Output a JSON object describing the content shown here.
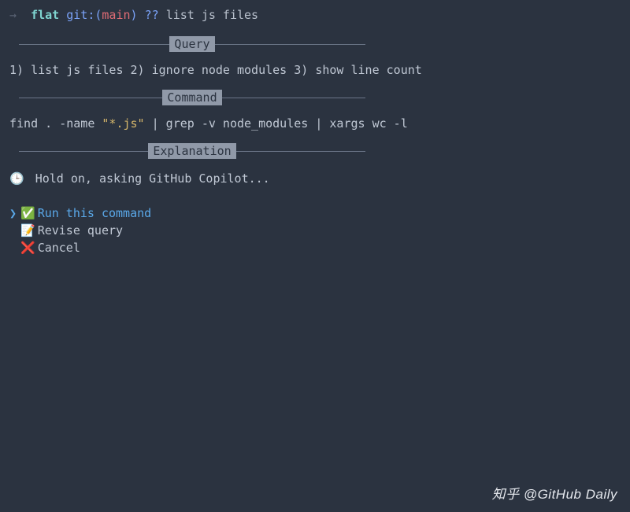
{
  "prompt": {
    "arrow": "→",
    "dirname": "flat",
    "git_label": "git:",
    "branch": "main",
    "qmarks": "??",
    "input": "list js files"
  },
  "sections": {
    "query_label": "Query",
    "query_text": "1) list js files 2) ignore node modules 3) show line count",
    "command_label": "Command",
    "command_prefix": "find . -name ",
    "command_string": "\"*.js\"",
    "command_suffix": " | grep -v node_modules | xargs wc -l",
    "explanation_label": "Explanation"
  },
  "status": {
    "icon": "🕒",
    "text": "Hold on, asking GitHub Copilot..."
  },
  "menu": {
    "caret": "❯",
    "items": [
      {
        "icon": "✅",
        "label": "Run this command",
        "selected": true
      },
      {
        "icon": "📝",
        "label": " Revise query",
        "selected": false
      },
      {
        "icon": "❌",
        "label": "Cancel",
        "selected": false
      }
    ]
  },
  "watermark": "知乎 @GitHub Daily"
}
